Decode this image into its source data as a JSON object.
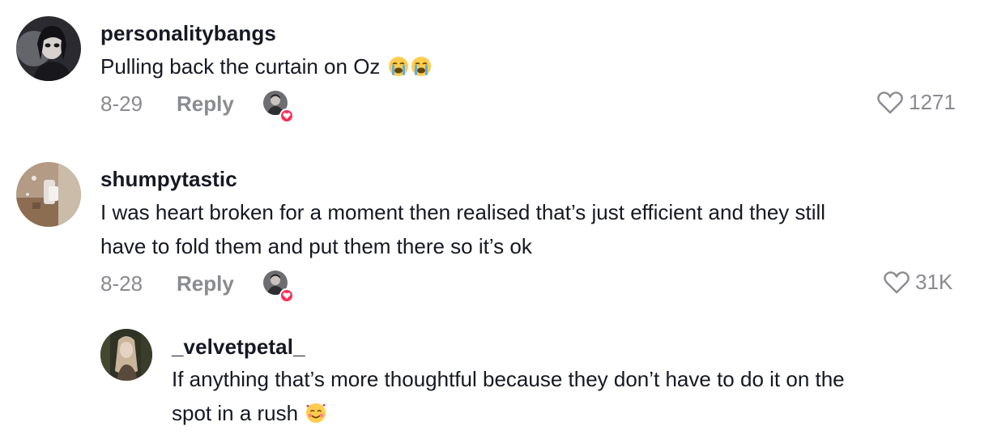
{
  "comments": [
    {
      "username": "personalitybangs",
      "text": "Pulling back the curtain on Oz",
      "emoji": "loudly-crying-face",
      "date": "8-29",
      "reply_label": "Reply",
      "likes": "1271",
      "creator_liked": true
    },
    {
      "username": "shumpytastic",
      "text_line1": "I was heart broken for a moment then realised that’s just efficient and they still",
      "text_line2": "have to fold them and put them there so it’s ok",
      "date": "8-28",
      "reply_label": "Reply",
      "likes": "31K",
      "creator_liked": true
    }
  ],
  "reply": {
    "username": "_velvetpetal_",
    "text_line1": "If anything that’s more thoughtful because they don’t have to do it on the",
    "text_line2": "spot in a rush",
    "emoji": "smiling-face-with-hearts"
  },
  "colors": {
    "text": "#161823",
    "muted": "#8a8b91",
    "badge": "#fe2c55"
  }
}
